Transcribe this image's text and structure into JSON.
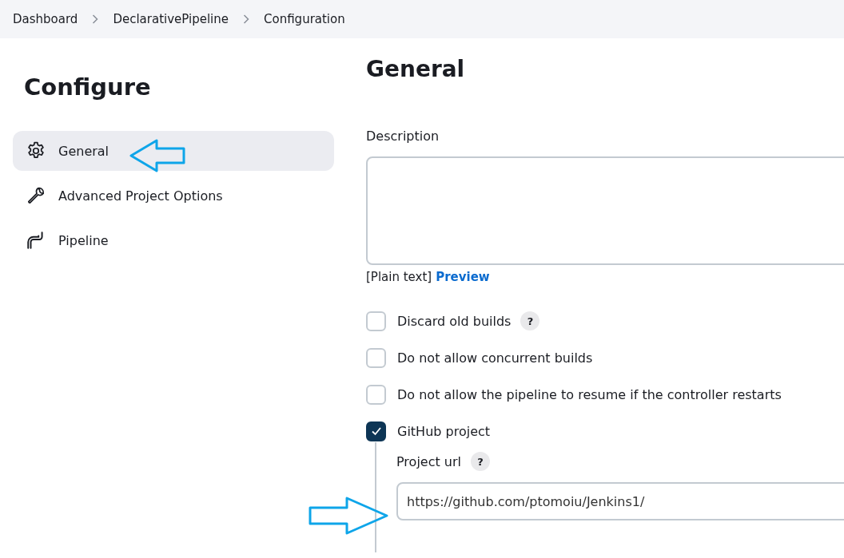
{
  "breadcrumbs": [
    "Dashboard",
    "DeclarativePipeline",
    "Configuration"
  ],
  "sidebar": {
    "title": "Configure",
    "items": [
      {
        "label": "General",
        "kind": "gear",
        "selected": true
      },
      {
        "label": "Advanced Project Options",
        "kind": "wrench",
        "selected": false
      },
      {
        "label": "Pipeline",
        "kind": "pipeline",
        "selected": false
      }
    ]
  },
  "main": {
    "title": "General",
    "description": {
      "label": "Description",
      "format_note": "[Plain text]",
      "preview_link": "Preview"
    },
    "options": [
      {
        "label": "Discard old builds",
        "checked": false,
        "help": "?"
      },
      {
        "label": "Do not allow concurrent builds",
        "checked": false
      },
      {
        "label": "Do not allow the pipeline to resume if the controller restarts",
        "checked": false
      },
      {
        "label": "GitHub project",
        "checked": true,
        "field": {
          "label": "Project url",
          "help": "?",
          "value": "https://github.com/ptomoiu/Jenkins1/"
        }
      }
    ]
  }
}
